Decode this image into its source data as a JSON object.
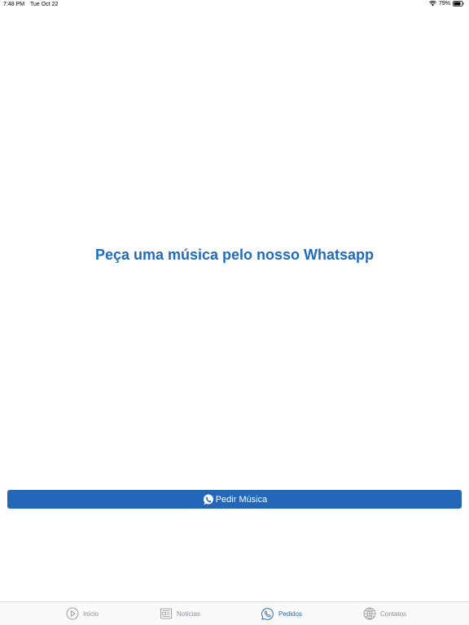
{
  "status_bar": {
    "time": "7:48 PM",
    "date": "Tue Oct 22",
    "battery_percent": "79%",
    "battery_level": 0.79
  },
  "main": {
    "headline": "Peça uma música pelo nosso Whatsapp",
    "request_button_label": "Pedir Música"
  },
  "tabs": [
    {
      "label": "Início",
      "icon": "play-circle-icon",
      "active": false
    },
    {
      "label": "Notícias",
      "icon": "newspaper-icon",
      "active": false
    },
    {
      "label": "Pedidos",
      "icon": "whatsapp-icon",
      "active": true
    },
    {
      "label": "Contatos",
      "icon": "globe-icon",
      "active": false
    }
  ],
  "colors": {
    "accent": "#1f6bbf",
    "button": "#2467b8",
    "tab_inactive": "#8e8e93"
  }
}
